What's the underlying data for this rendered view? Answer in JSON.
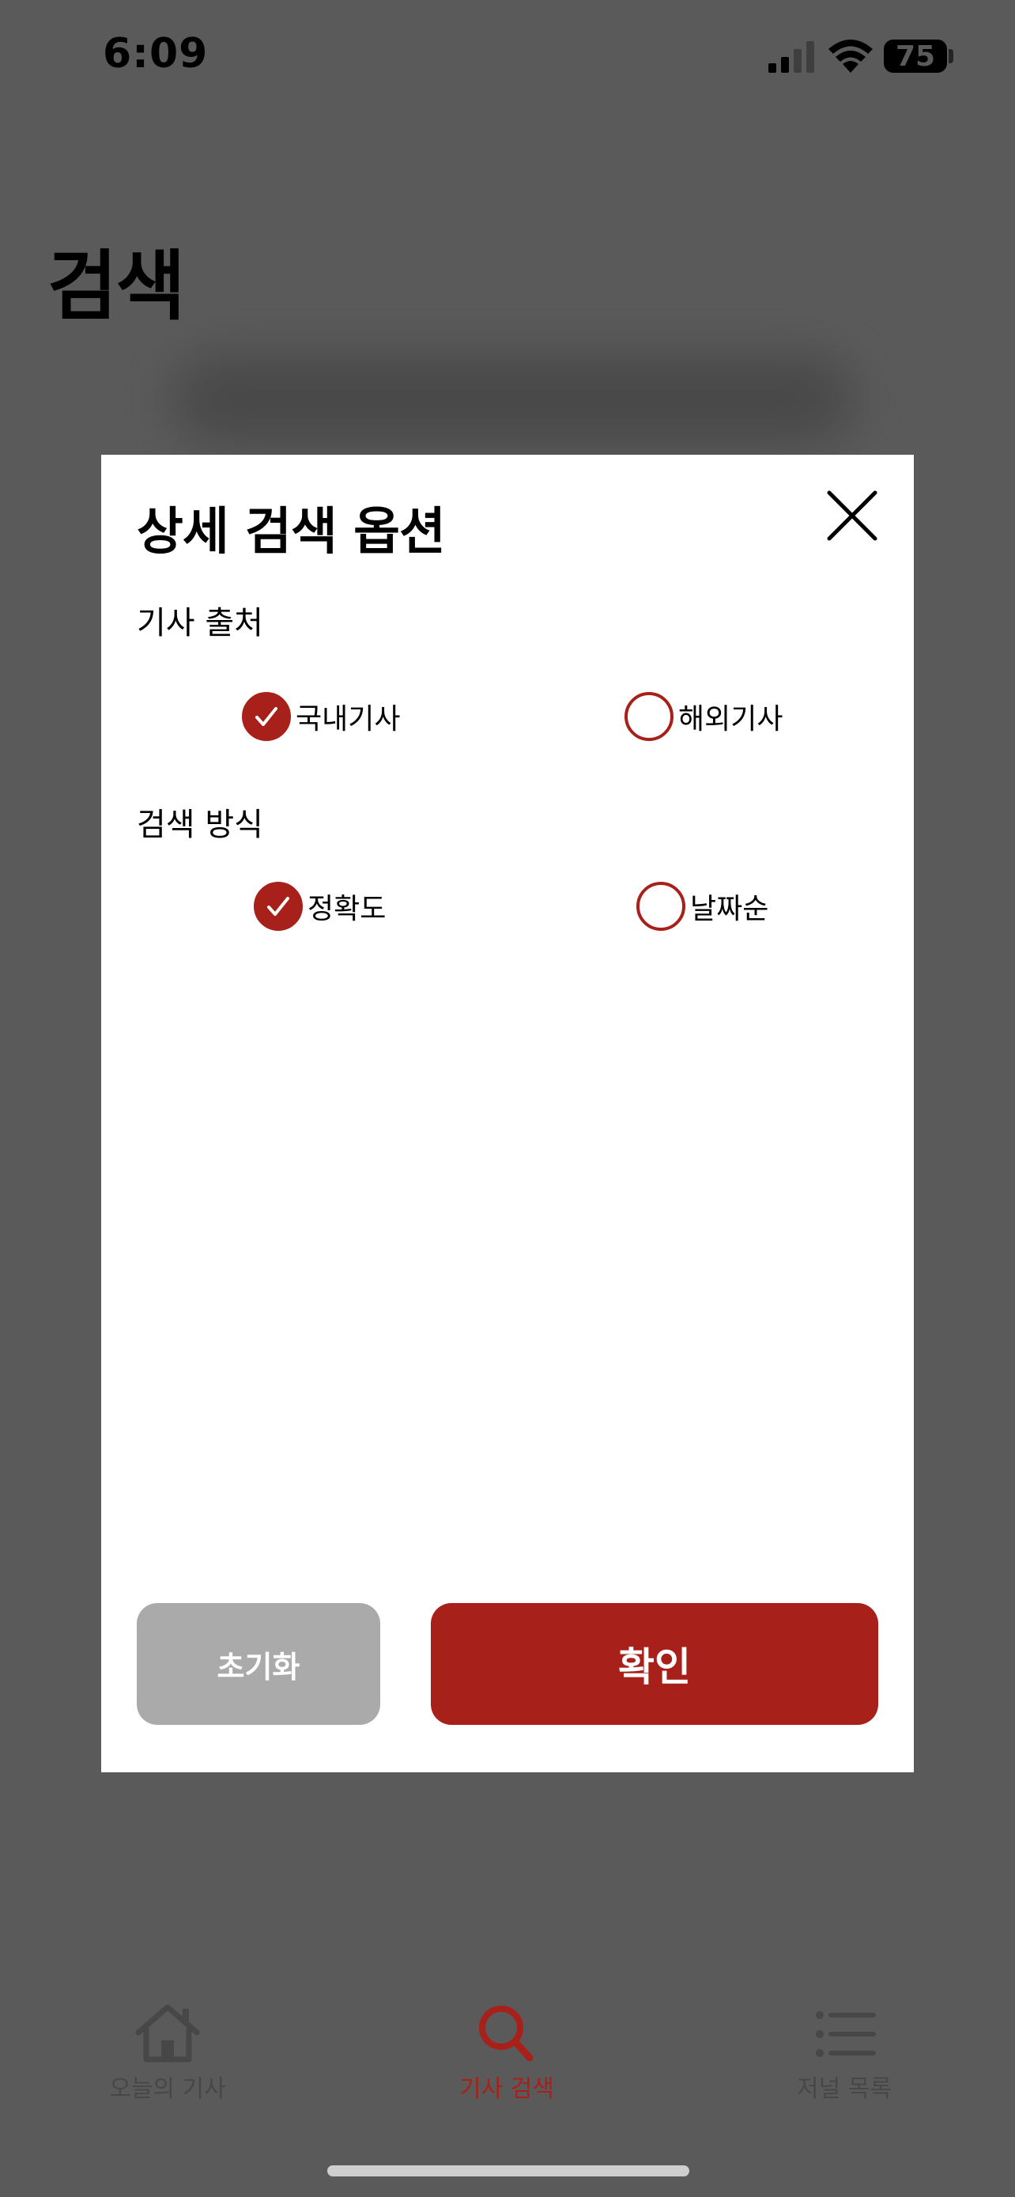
{
  "status_bar": {
    "time": "6:09",
    "battery": "75",
    "icons": [
      "cellular-signal-icon",
      "wifi-icon",
      "battery-icon"
    ]
  },
  "page": {
    "title": "검색"
  },
  "modal": {
    "title": "상세 검색 옵션",
    "close_icon": "close-icon",
    "source_section": {
      "label": "기사 출처",
      "options": [
        {
          "label": "국내기사",
          "checked": true
        },
        {
          "label": "해외기사",
          "checked": false
        }
      ]
    },
    "method_section": {
      "label": "검색 방식",
      "options": [
        {
          "label": "정확도",
          "checked": true
        },
        {
          "label": "날짜순",
          "checked": false
        }
      ]
    },
    "reset_label": "초기화",
    "confirm_label": "확인"
  },
  "tab_bar": {
    "items": [
      {
        "label": "오늘의 기사",
        "icon": "home-icon",
        "active": false
      },
      {
        "label": "기사 검색",
        "icon": "search-icon",
        "active": true
      },
      {
        "label": "저널 목록",
        "icon": "list-icon",
        "active": false
      }
    ]
  },
  "colors": {
    "accent": "#a8201a",
    "overlay": "#5a5a5a",
    "reset_button": "#aaaaaa"
  }
}
